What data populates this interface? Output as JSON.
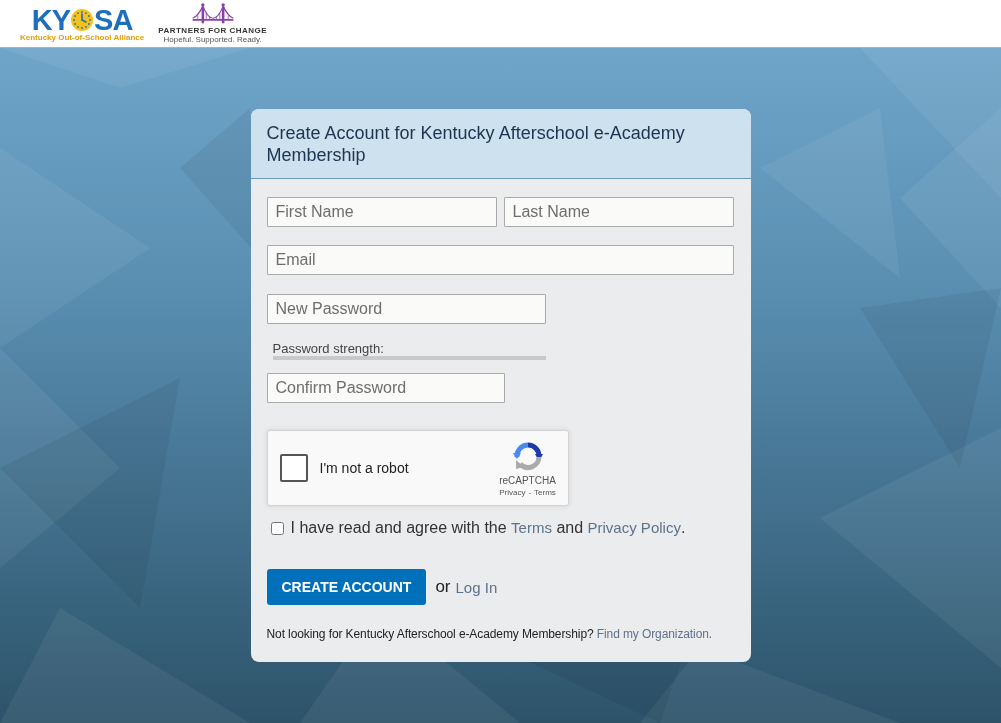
{
  "header": {
    "brand_logo": {
      "letters_before": "KY",
      "letters_after": "SA",
      "tagline": "Kentucky Out-of-School Alliance"
    },
    "partner_logo": {
      "name": "PARTNERS FOR CHANGE",
      "tagline": "Hopeful. Supported. Ready."
    }
  },
  "form": {
    "title": "Create Account for Kentucky Afterschool e-Academy Membership",
    "name_fields": [
      {
        "placeholder": "First Name"
      },
      {
        "placeholder": "Last Name"
      }
    ],
    "email_field": {
      "placeholder": "Email"
    },
    "password_field": {
      "placeholder": "New Password"
    },
    "password_strength": {
      "label": "Password strength:"
    },
    "confirm_password_field": {
      "placeholder": "Confirm Password"
    },
    "captcha": {
      "label": "I'm not a robot",
      "checked": false,
      "brand": "reCAPTCHA",
      "links": [
        "Privacy",
        "Terms"
      ],
      "separator": "-"
    },
    "agreement": {
      "checked": false,
      "parts": [
        {
          "kind": "text",
          "text": "I have read and agree with the "
        },
        {
          "kind": "link",
          "text": "Terms"
        },
        {
          "kind": "text",
          "text": " and "
        },
        {
          "kind": "link",
          "text": "Privacy Policy"
        },
        {
          "kind": "text",
          "text": "."
        }
      ]
    },
    "submit_button": "CREATE ACCOUNT",
    "alternative": {
      "text": "or",
      "link": "Log In"
    },
    "footer_note": {
      "text": "Not looking for Kentucky Afterschool e-Academy Membership?",
      "link": "Find my Organization."
    }
  }
}
